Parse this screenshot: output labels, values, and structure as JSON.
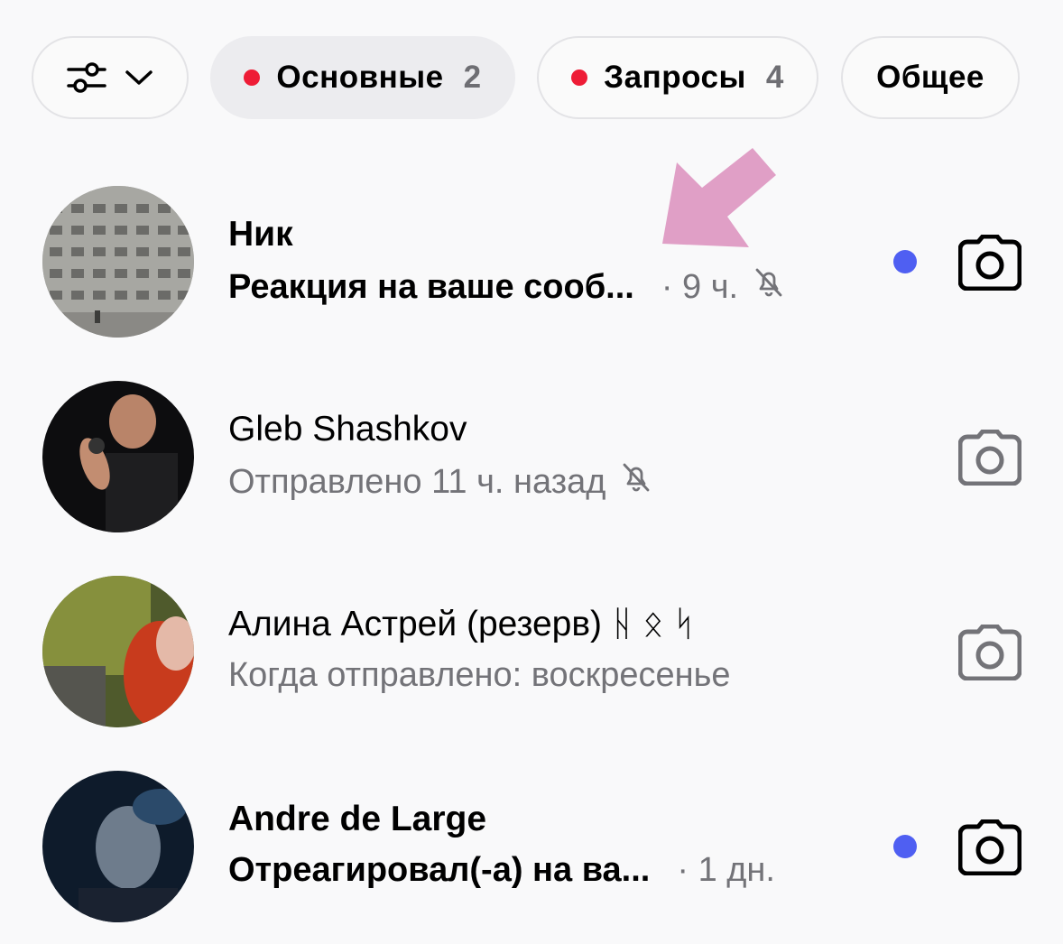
{
  "filters": {
    "options_icon": "sliders-icon",
    "dropdown_icon": "chevron-down-icon",
    "chips": [
      {
        "label": "Основные",
        "count": "2",
        "has_dot": true,
        "active": true
      },
      {
        "label": "Запросы",
        "count": "4",
        "has_dot": true,
        "active": false
      },
      {
        "label": "Общее",
        "count": "",
        "has_dot": false,
        "active": false
      }
    ]
  },
  "colors": {
    "accent_dot": "#4f5ff2",
    "red_dot": "#ee1c36",
    "arrow": "#e09fc6",
    "muted_text": "#737378"
  },
  "conversations": [
    {
      "name": "Ник",
      "message": "Реакция на ваше сооб...",
      "time": "· 9 ч.",
      "muted": true,
      "unread": true
    },
    {
      "name": "Gleb Shashkov",
      "message": "Отправлено 11 ч. назад",
      "time": "",
      "muted": true,
      "unread": false
    },
    {
      "name": "Алина Астрей (резерв) ᚺ ᛟ ᛋ",
      "message": "Когда отправлено: воскресенье",
      "time": "",
      "muted": false,
      "unread": false
    },
    {
      "name": "Andre de Large",
      "message": "Отреагировал(-а) на ва...",
      "time": "· 1 дн.",
      "muted": false,
      "unread": true
    }
  ]
}
